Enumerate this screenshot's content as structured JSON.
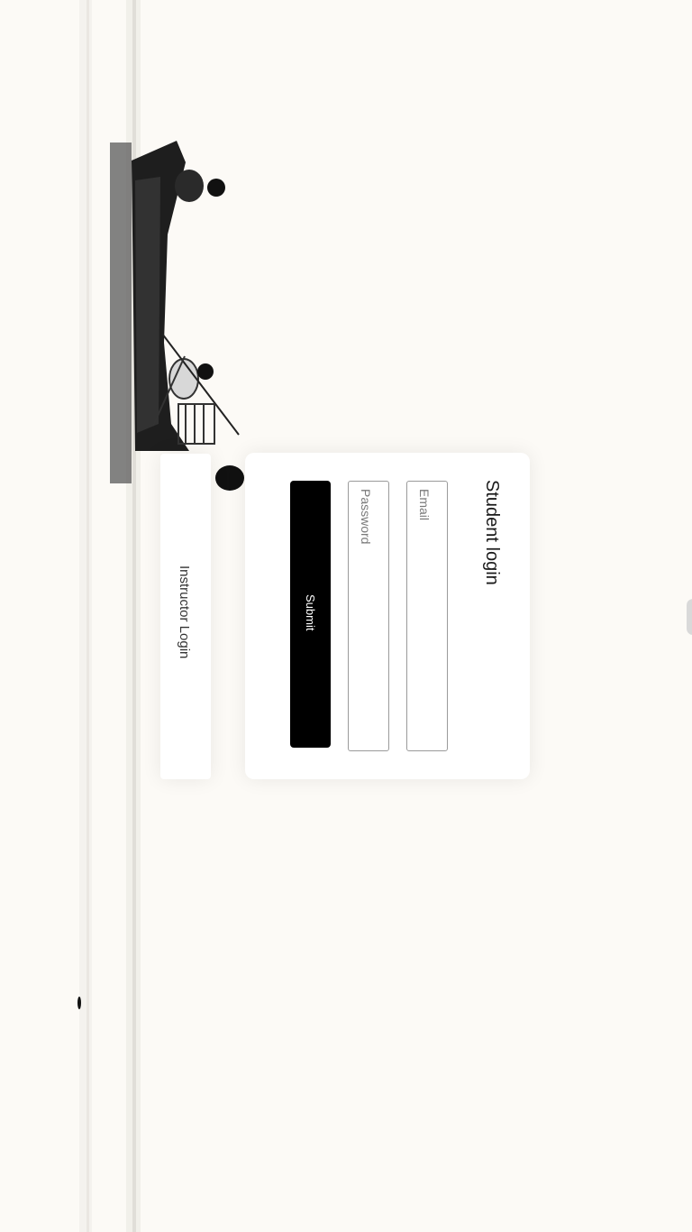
{
  "login": {
    "title": "Student login",
    "email_placeholder": "Email",
    "password_placeholder": "Password",
    "submit_label": "Submit"
  },
  "instructor": {
    "link_label": "Instructor Login"
  },
  "background": {
    "art": "ink-wash-fishing-boat"
  }
}
